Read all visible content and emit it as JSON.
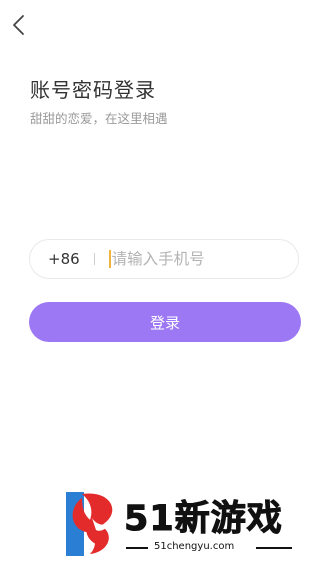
{
  "header": {
    "back_icon": "chevron-left-icon"
  },
  "title": "账号密码登录",
  "subtitle": "甜甜的恋爱，在这里相遇",
  "phone": {
    "country_code": "+86",
    "placeholder": "请输入手机号",
    "value": ""
  },
  "login_button": "登录",
  "watermark": {
    "brand": "51新游戏",
    "url": "51chengyu.com"
  },
  "colors": {
    "accent": "#9d78f4",
    "caret": "#f0b43c",
    "text": "#333333",
    "subtext": "#9a9a9a"
  }
}
